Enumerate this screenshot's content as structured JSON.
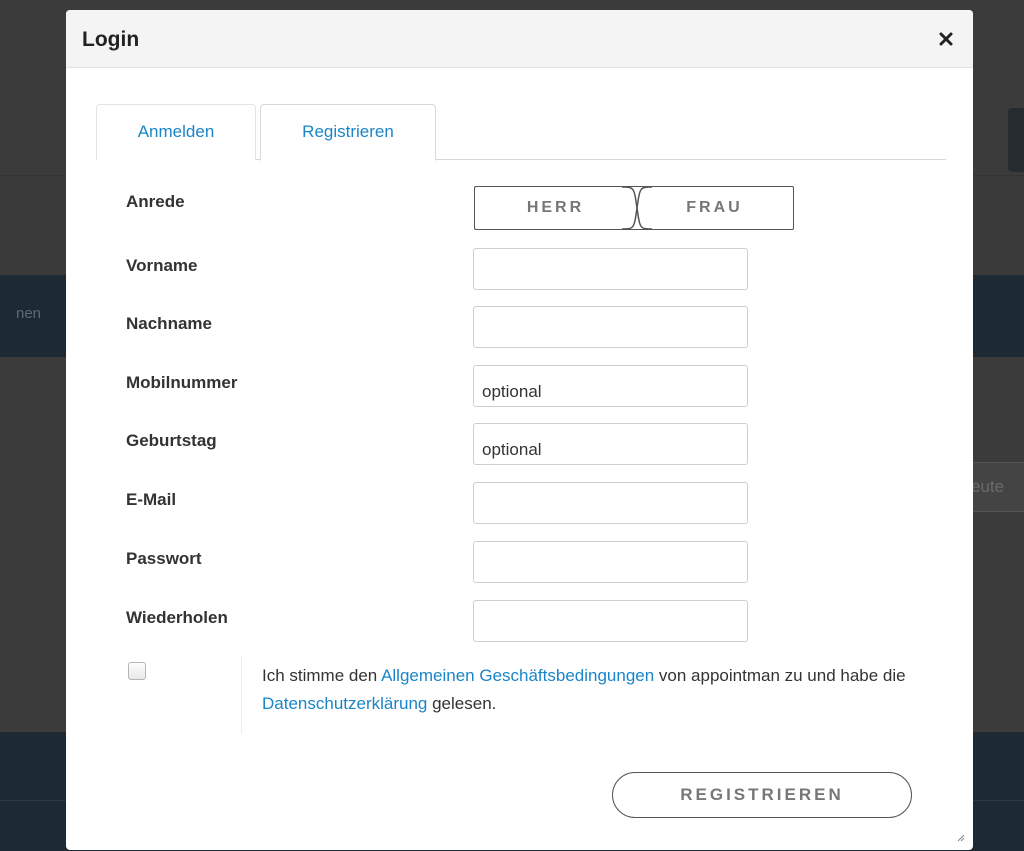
{
  "background": {
    "left_fragment": "nen",
    "right_fragment": "eute"
  },
  "dialog": {
    "title": "Login",
    "close_symbol": "×"
  },
  "tabs": [
    {
      "label": "Anmelden",
      "active": false
    },
    {
      "label": "Registrieren",
      "active": true
    }
  ],
  "form": {
    "salutation_label": "Anrede",
    "salutation_options": [
      "HERR",
      "FRAU"
    ],
    "first_name_label": "Vorname",
    "first_name_value": "",
    "last_name_label": "Nachname",
    "last_name_value": "",
    "mobile_label": "Mobilnummer",
    "mobile_placeholder": "optional",
    "birthday_label": "Geburtstag",
    "birthday_placeholder": "optional",
    "email_label": "E-Mail",
    "email_value": "",
    "password_label": "Passwort",
    "password_value": "",
    "repeat_label": "Wiederholen",
    "repeat_value": ""
  },
  "consent": {
    "text_1": "Ich stimme den ",
    "link_terms": "Allgemeinen Geschäftsbedingungen",
    "text_2": " von appointman zu und habe die ",
    "link_privacy": "Datenschutzerklärung",
    "text_3": " gelesen.",
    "checked": false
  },
  "submit_label": "REGISTRIEREN",
  "colors": {
    "link": "#1a85c8",
    "overlay": "#3d3d3d"
  }
}
